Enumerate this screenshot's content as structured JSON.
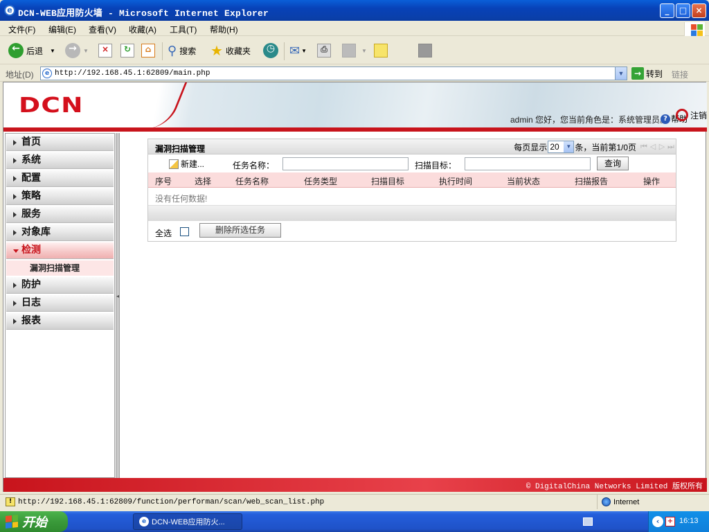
{
  "window": {
    "title": "DCN-WEB应用防火墙 - Microsoft Internet Explorer",
    "minimize": "_",
    "maximize": "□",
    "close": "×"
  },
  "menubar": {
    "items": [
      "文件(F)",
      "编辑(E)",
      "查看(V)",
      "收藏(A)",
      "工具(T)",
      "帮助(H)"
    ]
  },
  "toolbar": {
    "back": "后退",
    "search": "搜索",
    "favorites": "收藏夹"
  },
  "address": {
    "label": "地址(D)",
    "url": "http://192.168.45.1:62809/main.php",
    "go": "转到",
    "links": "链接"
  },
  "header": {
    "logo": "DCN",
    "userinfo": "admin 您好，您当前角色是：系统管理员。",
    "help": "帮助",
    "logout": "注销"
  },
  "sidebar": {
    "items": [
      {
        "label": "首页"
      },
      {
        "label": "系统"
      },
      {
        "label": "配置"
      },
      {
        "label": "策略"
      },
      {
        "label": "服务"
      },
      {
        "label": "对象库"
      },
      {
        "label": "检测"
      },
      {
        "label": "防护"
      },
      {
        "label": "日志"
      },
      {
        "label": "报表"
      }
    ],
    "active_index": 6,
    "subitem": "漏洞扫描管理"
  },
  "panel": {
    "title": "漏洞扫描管理",
    "per_page_prefix": "每页显示",
    "per_page_value": "20",
    "per_page_suffix": "条，当前第1/0页",
    "new_button": "新建...",
    "task_name_label": "任务名称：",
    "task_name_value": "",
    "target_label": "扫描目标：",
    "target_value": "",
    "query_button": "查询",
    "columns": [
      "序号",
      "选择",
      "任务名称",
      "任务类型",
      "扫描目标",
      "执行时间",
      "当前状态",
      "扫描报告",
      "操作"
    ],
    "empty_text": "没有任何数据!",
    "select_all": "全选",
    "delete_button": "删除所选任务"
  },
  "footer": {
    "copyright": "© DigitalChina Networks Limited 版权所有"
  },
  "status": {
    "url": "http://192.168.45.1:62809/function/performan/scan/web_scan_list.php",
    "zone": "Internet"
  },
  "taskbar": {
    "start": "开始",
    "task": "DCN-WEB应用防火...",
    "clock": "16:13"
  },
  "colors": {
    "brand_red": "#c8141c",
    "xp_blue": "#0a5fd8",
    "row_pink": "#fbdcdc"
  }
}
